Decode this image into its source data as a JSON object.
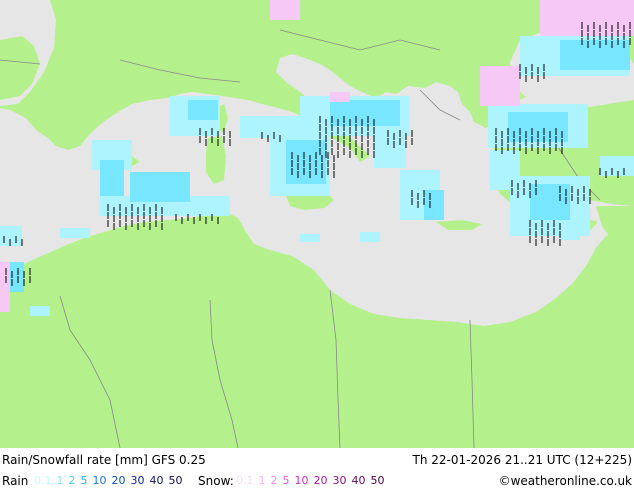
{
  "header": {
    "title": "Rain/Snowfall rate [mm] GFS 0.25",
    "datetime": "Th 22-01-2026 21..21 UTC (12+225)"
  },
  "legend": {
    "rain_label": "Rain",
    "rain_scale": [
      {
        "text": "0.1",
        "color": "#c8f8ff"
      },
      {
        "text": "1",
        "color": "#7fe8ff"
      },
      {
        "text": "2",
        "color": "#56c8f0"
      },
      {
        "text": "5",
        "color": "#2ea8e0"
      },
      {
        "text": "10",
        "color": "#1878d0"
      },
      {
        "text": "20",
        "color": "#1050b8"
      },
      {
        "text": "30",
        "color": "#102890"
      },
      {
        "text": "40",
        "color": "#101870"
      },
      {
        "text": "50",
        "color": "#100850"
      }
    ],
    "snow_label": "Snow:",
    "snow_scale": [
      {
        "text": "0.1",
        "color": "#fcd8fc"
      },
      {
        "text": "1",
        "color": "#f8b0f0"
      },
      {
        "text": "2",
        "color": "#f090e8"
      },
      {
        "text": "5",
        "color": "#e060d8"
      },
      {
        "text": "10",
        "color": "#c830c0"
      },
      {
        "text": "20",
        "color": "#a818a0"
      },
      {
        "text": "30",
        "color": "#881080"
      },
      {
        "text": "40",
        "color": "#680860"
      },
      {
        "text": "50",
        "color": "#480040"
      }
    ],
    "credit": "©weatheronline.co.uk"
  },
  "colors": {
    "sea": "#e6e6e6",
    "land": "#b4f08c",
    "border": "#888888",
    "rain_light": "#aef4ff",
    "rain_medium": "#78e6ff",
    "snow_light": "#f6c8f6",
    "marker": "#000000"
  }
}
